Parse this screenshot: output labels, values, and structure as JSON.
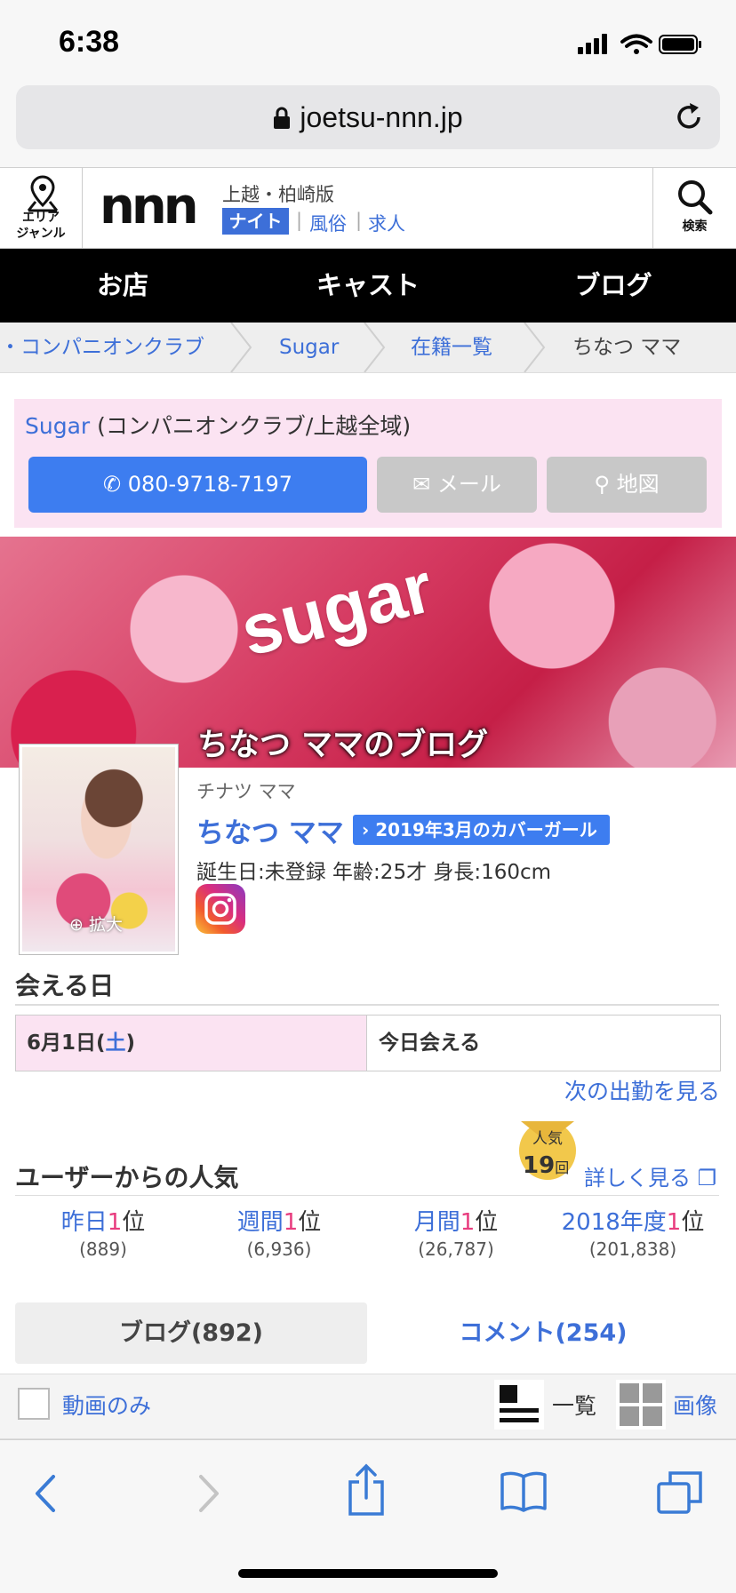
{
  "status_bar": {
    "time": "6:38"
  },
  "browser": {
    "url": "joetsu-nnn.jp"
  },
  "header": {
    "area_label_line1": "エリア",
    "area_label_line2": "ジャンル",
    "logo_text": "nnn",
    "region": "上越・柏崎版",
    "genres": [
      "ナイト",
      "風俗",
      "求人"
    ],
    "search_label": "検索"
  },
  "nav": {
    "items": [
      "お店",
      "キャスト",
      "ブログ"
    ]
  },
  "breadcrumb": [
    "・コンパニオンクラブ",
    "Sugar",
    "在籍一覧",
    "ちなつ ママ"
  ],
  "shop": {
    "name": "Sugar",
    "category": "(コンパニオンクラブ/上越全域)",
    "phone": "080-9718-7197",
    "mail_label": "メール",
    "map_label": "地図"
  },
  "banner": {
    "word": "sugar",
    "blog_title": "ちなつ ママのブログ"
  },
  "profile": {
    "kana": "チナツ ママ",
    "name": "ちなつ ママ",
    "cover_badge": "2019年3月のカバーガール",
    "stats": "誕生日:未登録 年齢:25才 身長:160cm",
    "zoom_label": "拡大",
    "instagram_icon": "instagram-icon"
  },
  "availability": {
    "title": "会える日",
    "date_prefix": "6月1日(",
    "date_day": "土",
    "date_suffix": ")",
    "status": "今日会える",
    "next_link": "次の出勤を見る"
  },
  "popularity": {
    "title": "ユーザーからの人気",
    "medal_label": "人気",
    "medal_count": "19",
    "medal_unit": "回",
    "details_link": "詳しく見る",
    "ranks": [
      {
        "prefix": "昨日",
        "rank": "1",
        "suffix": "位",
        "count": "(889)"
      },
      {
        "prefix": "週間",
        "rank": "1",
        "suffix": "位",
        "count": "(6,936)"
      },
      {
        "prefix": "月間",
        "rank": "1",
        "suffix": "位",
        "count": "(26,787)"
      },
      {
        "prefix": "2018年度",
        "rank": "1",
        "suffix": "位",
        "count": "(201,838)"
      }
    ]
  },
  "tabs": {
    "blog": "ブログ(892)",
    "comment": "コメント(254)"
  },
  "filter": {
    "video_only": "動画のみ",
    "list_label": "一覧",
    "image_label": "画像"
  },
  "colors": {
    "link": "#3d6fd8",
    "accent_pink": "#e83c7e",
    "button_blue": "#3d7df0",
    "shop_bg": "#fbe3f2"
  }
}
